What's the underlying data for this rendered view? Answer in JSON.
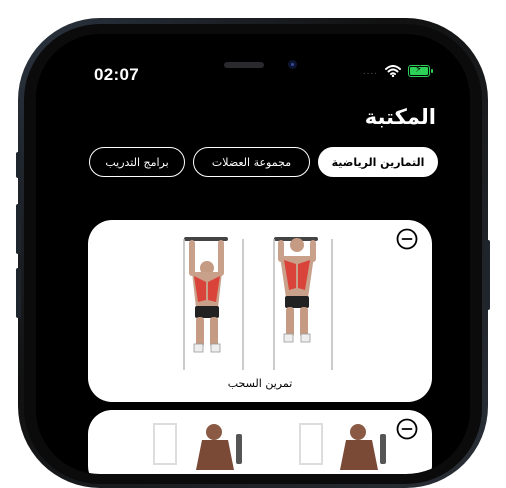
{
  "status_bar": {
    "time": "02:07",
    "signal_dots": "...."
  },
  "header": {
    "title": "المكتبة"
  },
  "tabs": [
    {
      "label": "التمارين الرياضية",
      "active": true
    },
    {
      "label": "مجموعة العضلات",
      "active": false
    },
    {
      "label": "برامج التدريب",
      "active": false
    }
  ],
  "exercises": [
    {
      "name": "تمرين السحب",
      "icon": "minus-circle-icon"
    },
    {
      "name": "",
      "icon": "minus-circle-icon"
    }
  ],
  "colors": {
    "background": "#000000",
    "card": "#ffffff",
    "battery": "#2ed158",
    "muscle_highlight": "#d9433a"
  }
}
